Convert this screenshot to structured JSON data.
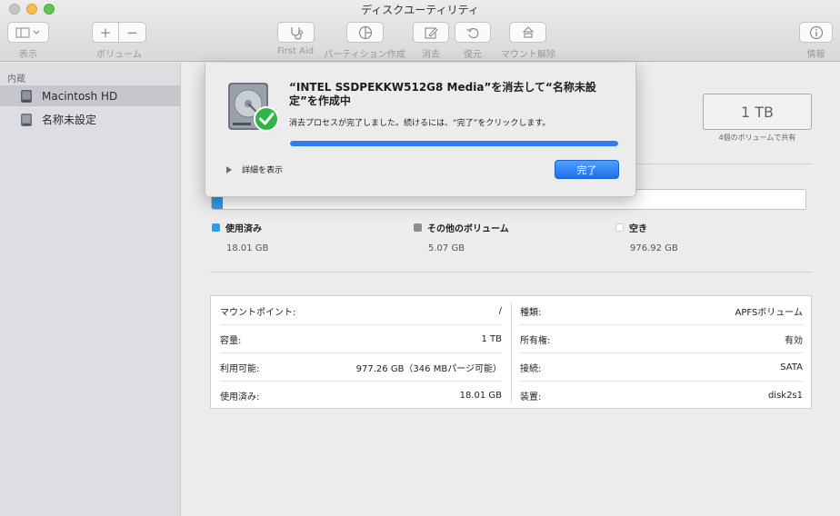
{
  "window": {
    "title": "ディスクユーティリティ"
  },
  "toolbar": {
    "view_label": "表示",
    "volume_label": "ボリューム",
    "volume_add": "+",
    "volume_remove": "−",
    "first_aid_label": "First Aid",
    "partition_label": "パーティション作成",
    "erase_label": "消去",
    "restore_label": "復元",
    "unmount_label": "マウント解除",
    "info_label": "情報"
  },
  "sidebar": {
    "section": "内蔵",
    "items": [
      {
        "label": "Macintosh HD",
        "selected": true
      },
      {
        "label": "名称未設定",
        "selected": false
      }
    ]
  },
  "capacity": {
    "value": "1 TB",
    "subtitle": "4個のボリュームで共有"
  },
  "usage": {
    "used_fraction": 0.0184,
    "legend": [
      {
        "label": "使用済み",
        "value": "18.01 GB",
        "color": "#2f9bf0"
      },
      {
        "label": "その他のボリューム",
        "value": "5.07 GB",
        "color": "#8e8e8e"
      },
      {
        "label": "空き",
        "value": "976.92 GB",
        "color": "#ffffff"
      }
    ]
  },
  "info": {
    "left": [
      {
        "key": "マウントポイント:",
        "value": "/"
      },
      {
        "key": "容量:",
        "value": "1 TB"
      },
      {
        "key": "利用可能:",
        "value": "977.26 GB（346 MBパージ可能）"
      },
      {
        "key": "使用済み:",
        "value": "18.01 GB"
      }
    ],
    "right": [
      {
        "key": "種類:",
        "value": "APFSボリューム"
      },
      {
        "key": "所有権:",
        "value": "有効"
      },
      {
        "key": "接続:",
        "value": "SATA"
      },
      {
        "key": "装置:",
        "value": "disk2s1"
      }
    ]
  },
  "sheet": {
    "title": "“INTEL SSDPEKKW512G8 Media”を消去して“名称未設定”を作成中",
    "message": "消去プロセスが完了しました。続けるには、“完了”をクリックします。",
    "progress": 1.0,
    "details_label": "詳細を表示",
    "done_label": "完了",
    "accent": "#2e7ef3"
  }
}
